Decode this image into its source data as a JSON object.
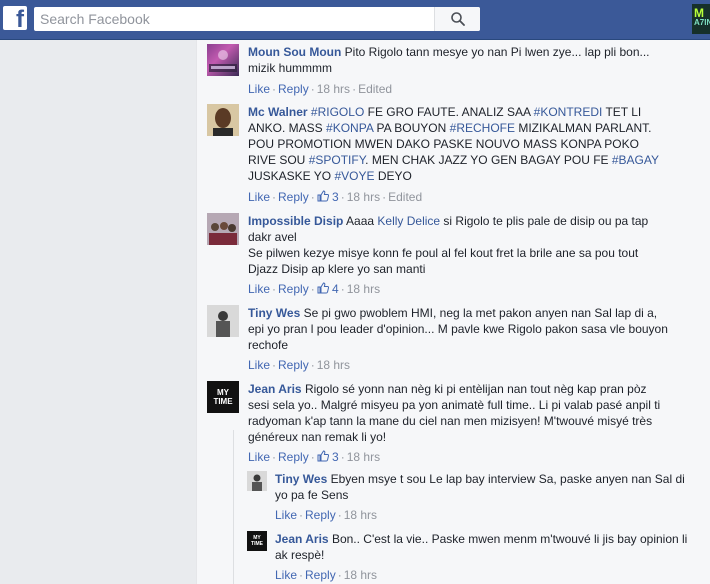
{
  "header": {
    "logo_letter": "f",
    "search_placeholder": "Search Facebook",
    "corner_app_text_top": "M",
    "corner_app_text_bottom": "A7IN"
  },
  "actions": {
    "like": "Like",
    "reply": "Reply",
    "edited": "Edited"
  },
  "comments": [
    {
      "author": "Moun Sou Moun",
      "text": "Pito Rigolo tann mesye yo nan Pi lwen zye... lap pli bon... mizik hummmm",
      "time": "18 hrs",
      "edited": true
    },
    {
      "author": "Mc Walner",
      "segments": [
        {
          "t": "#RIGOLO",
          "tag": true
        },
        {
          "t": " FE GRO FAUTE. ANALIZ SAA ",
          "tag": false
        },
        {
          "t": "#KONTREDI",
          "tag": true
        },
        {
          "t": " TET LI ANKO. MASS ",
          "tag": false
        },
        {
          "t": "#KONPA",
          "tag": true
        },
        {
          "t": " PA BOUYON ",
          "tag": false
        },
        {
          "t": "#RECHOFE",
          "tag": true
        },
        {
          "t": " MIZIKALMAN PARLANT. POU PROMOTION MWEN DAKO PASKE NOUVO MASS KONPA POKO RIVE SOU ",
          "tag": false
        },
        {
          "t": "#SPOTIFY",
          "tag": true
        },
        {
          "t": ". MEN CHAK JAZZ YO GEN BAGAY POU FE ",
          "tag": false
        },
        {
          "t": "#BAGAY",
          "tag": true
        },
        {
          "t": " JUSKASKE YO ",
          "tag": false
        },
        {
          "t": "#VOYE",
          "tag": true
        },
        {
          "t": " DEYO",
          "tag": false
        }
      ],
      "likes": "3",
      "time": "18 hrs",
      "edited": true
    },
    {
      "author": "Impossible Disip",
      "mention": "Kelly Delice",
      "text_before": "Aaaa ",
      "text_after": " si Rigolo te plis pale de disip ou pa tap dakr avel",
      "text_para2": "Se pilwen kezye misye konn fe poul al fel kout fret la brile ane sa pou tout Djazz Disip ap klere yo san manti",
      "likes": "4",
      "time": "18 hrs"
    },
    {
      "author": "Tiny Wes",
      "text": "Se pi gwo pwoblem HMI, neg la met pakon anyen nan Sal lap di a, epi yo pran l pou leader d'opinion... M pavle kwe Rigolo pakon sasa vle bouyon rechofe",
      "time": "18 hrs"
    },
    {
      "author": "Jean Aris",
      "text": "Rigolo sé yonn nan nèg ki pi entèlijan nan tout nèg kap pran pòz sesi sela yo.. Malgré misyeu pa yon animatè full time.. Li pi valab pasé anpil ti radyoman k'ap tann la mane du ciel nan men mizisyen! M'twouvé misyé très généreux nan remak li yo!",
      "likes": "3",
      "time": "18 hrs",
      "avatar_text": "MY TIME"
    }
  ],
  "replies": [
    {
      "author": "Tiny Wes",
      "text": "Ebyen msye t sou Le lap bay interview Sa, paske anyen nan Sal di yo pa fe Sens",
      "time": "18 hrs"
    },
    {
      "author": "Jean Aris",
      "text": "Bon.. C'est la vie.. Paske mwen menm m'twouvé li jis bay opinion li ak respè!",
      "time": "18 hrs",
      "avatar_text": "MY TIME"
    }
  ]
}
